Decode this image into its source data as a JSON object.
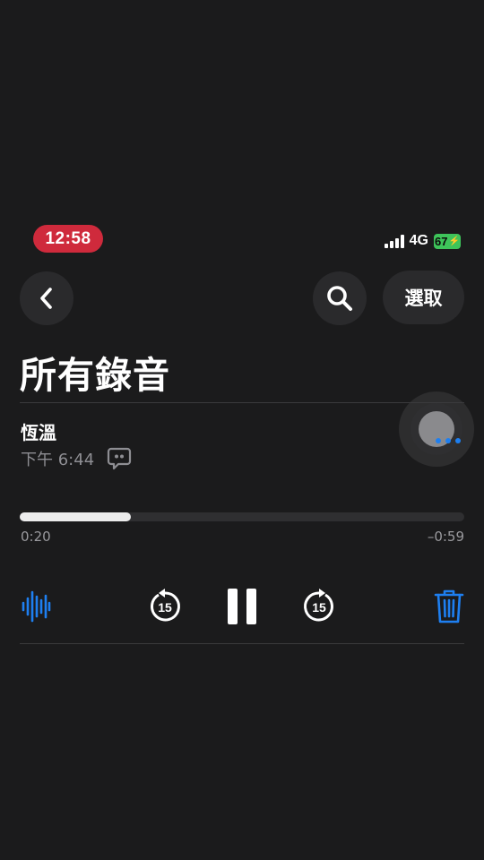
{
  "status_bar": {
    "time": "12:58",
    "network": "4G",
    "battery": "67",
    "battery_color": "#3ec45a",
    "time_pill_color": "#cf2a3c"
  },
  "nav": {
    "back_icon": "chevron-left-icon",
    "search_icon": "search-icon",
    "select_label": "選取"
  },
  "page": {
    "title": "所有錄音"
  },
  "recording": {
    "name": "恆溫",
    "date": "下午 6:44",
    "transcript_icon": "transcript-bubble-icon"
  },
  "playback": {
    "progress": 0.25,
    "elapsed": "0:20",
    "remaining": "–0:59"
  },
  "controls": {
    "waveform_icon": "waveform-icon",
    "skip_back_label": "15",
    "skip_forward_label": "15",
    "pause_icon": "pause-icon",
    "trash_icon": "trash-icon",
    "accent_color": "#1e7ff0"
  }
}
